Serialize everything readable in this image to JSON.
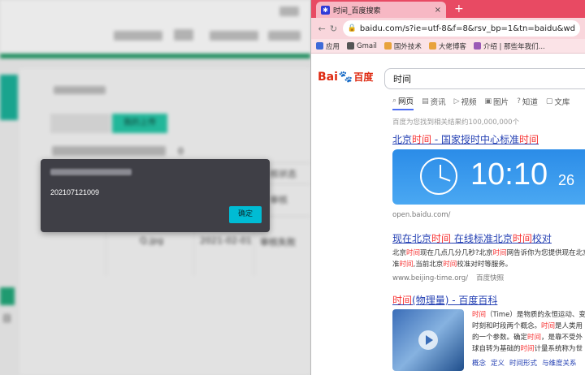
{
  "left_app": {
    "tabs": [
      "我的上传"
    ],
    "count": "0",
    "columns": [
      "核状态",
      "审核"
    ],
    "row": {
      "file": "Q.jpg",
      "date": "2021-02-01",
      "status": "审核失败"
    },
    "footer_cell": "日"
  },
  "dialog": {
    "message": "202107121009",
    "ok_label": "确定"
  },
  "browser": {
    "tab_title": "时间_百度搜索",
    "tab_close": "×",
    "new_tab": "+",
    "url": "baidu.com/s?ie=utf-8&f=8&rsv_bp=1&tn=baidu&wd",
    "bookmarks": [
      {
        "label": "应用",
        "color": "#3f6ad8"
      },
      {
        "label": "Gmail",
        "color": "#555555"
      },
      {
        "label": "国外技术",
        "color": "#e8a33c"
      },
      {
        "label": "大佬博客",
        "color": "#e8a33c"
      },
      {
        "label": "介绍 | 那些年我们...",
        "color": "#9b59b6"
      }
    ]
  },
  "search": {
    "logo_bai": "Bai",
    "logo_paw": "🐾",
    "logo_du": "百度",
    "query": "时间",
    "tabs": [
      {
        "icon": "⌕",
        "label": "网页"
      },
      {
        "icon": "▤",
        "label": "资讯"
      },
      {
        "icon": "▷",
        "label": "视频"
      },
      {
        "icon": "▣",
        "label": "图片"
      },
      {
        "icon": "?",
        "label": "知道"
      },
      {
        "icon": "▢",
        "label": "文库"
      }
    ],
    "result_count": "百度为您找到相关结果约100,000,000个"
  },
  "results": {
    "r1": {
      "pre": "北京",
      "hl1": "时间",
      "mid": " - 国家授时中心标准",
      "hl2": "时间",
      "clock_time": "10:10",
      "clock_sec": "26",
      "source": "open.baidu.com/"
    },
    "r2": {
      "pre": "现在北京",
      "hl1": "时间",
      "mid": " 在线标准北京",
      "hl2": "时间",
      "post": "校对",
      "abs_a": "北京",
      "abs_hl1": "时间",
      "abs_b": "现在几点几分几秒?北京",
      "abs_hl2": "时间",
      "abs_c": "网告诉你为您提供现在北京",
      "abs_d": "准",
      "abs_hl3": "时间",
      "abs_e": ",当前北京",
      "abs_hl4": "时间",
      "abs_f": "校准对时等服务。",
      "source": "www.beijing-time.org/",
      "snapshot": "百度快照"
    },
    "r3": {
      "hl": "时间",
      "post": "(物理量) - 百度百科",
      "abs_a": "时间",
      "abs_b": "（Time）是物质的永恒运动、变",
      "abs_c": "时刻和时段两个概念。",
      "abs_hl": "时间",
      "abs_d": "是人类用",
      "abs_e": "的一个参数。确定",
      "abs_hl2": "时间",
      "abs_f": "，是靠不受外",
      "abs_g": "球自转为基础的",
      "abs_hl3": "时间",
      "abs_h": "计量系统称为世",
      "links": [
        "概念",
        "定义",
        "时间形式",
        "与维度关系"
      ]
    }
  }
}
